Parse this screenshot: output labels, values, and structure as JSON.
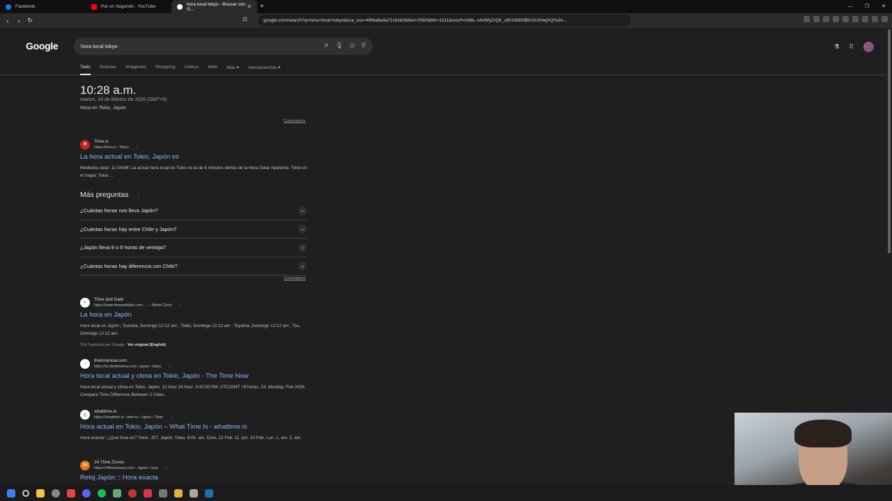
{
  "browser": {
    "tabs": [
      {
        "label": "Facebook",
        "color": "#1877f2"
      },
      {
        "label": "Por un Segundo - YouTube",
        "color": "#ff0000"
      },
      {
        "label": "hora local tokyo - Buscar con G...",
        "color": "#ffffff"
      }
    ],
    "new_tab": "+",
    "url": "google.com/search?q=hora+local+tokyo&sca_esv=4f66a6a4a71c61b0&biw=2560&bih=1311&sxsrf=ANbL-n4sWyZrQK_x901t5893BIUGXHwjXQ%3A..."
  },
  "google": {
    "logo": "Google",
    "query": "hora local tokyo",
    "tabs": [
      "Todo",
      "Noticias",
      "Imágenes",
      "Shopping",
      "Videos",
      "Web",
      "Más ▾",
      "Herramientas ▾"
    ],
    "clock": {
      "time": "10:28 a.m.",
      "date": "martes, 24 de febrero de 2026 (GMT+9)",
      "place": "Hora en Tokio, Japón"
    },
    "comentarios": "Comentarios",
    "paa_title": "Más preguntas",
    "paa": [
      "¿Cuántas horas nos lleva Japón?",
      "¿Cuántas horas hay entre Chile y Japón?",
      "¿Japón lleva 8 o 9 horas de ventaja?",
      "¿Cuántas horas hay diferencia con Chile?"
    ],
    "results": [
      {
        "site": "Time.is",
        "url": "https://time.is › Tokyo",
        "title": "La hora actual en Tokio, Japón es",
        "snippet": "Mediodía solar: 11:54AM; La actual hora local en Tokio es la de 6 minutos detrás de la Hora Solar Aparente. Tokio en el mapa: Tokio ...",
        "fav_color": "#c5221f",
        "fav_text": "⏱"
      },
      {
        "site": "Time and Date",
        "url": "https://www.timeanddate.com › ... › World Clock",
        "title": "La hora en Japón",
        "snippet": "Hora local en Japón ; Suzuka, Domingo 12:12 am ; Tokio, Domingo 12:12 am ; Toyama, Domingo 12:12 am ; Tsu, Domingo 12:12 am.",
        "fav_color": "#ffffff",
        "fav_text": "◐"
      },
      {
        "site": "thetimenow.com",
        "url": "https://es.thetimenow.com › japan › tokyo",
        "title": "Hora local actual y clima en Tokio, Japón - The Time Now",
        "snippet": "Hora local actual y clima en Tokio, Japón. 12 hour 24 hour. 3:42:00 PM. UTC/GMT +9 horas. 23. Monday. Feb 2026. Compare Time Difference Between 2 Cities.",
        "fav_color": "#ffffff",
        "fav_text": "◔"
      },
      {
        "site": "whattime.is",
        "url": "https://whattime.is › time-in › Japón › Tokio",
        "title": "Hora actual en Tokio, Japón – What Time Is - whattime.is",
        "snippet": "Hora exacta / ¿Qué hora es? Tokio. JST. Japón. Tokio. 8:00. am. Dom, 22 Feb. 11. pm. 23 Feb. Lun. 1. am. 2. am.",
        "fav_color": "#ffffff",
        "fav_text": "◴"
      },
      {
        "site": "24 Time Zones",
        "url": "https://24timezones.com › Japón › hora",
        "title": "Reloj Japón :: Hora exacta",
        "snippet": "",
        "fav_color": "#e8710a",
        "fav_text": "24"
      }
    ],
    "translated_prefix": "Traducido por Google ·",
    "translated_link": "Ver original (English)"
  }
}
